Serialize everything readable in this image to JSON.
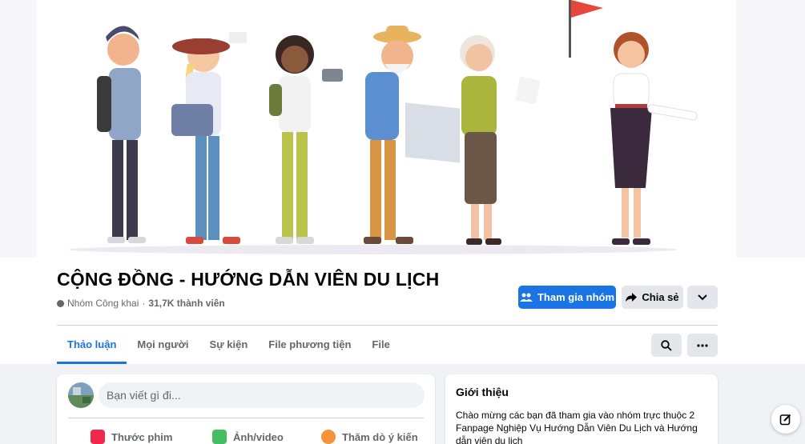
{
  "group": {
    "title": "CỘNG ĐỒNG - HƯỚNG DẪN VIÊN DU LỊCH",
    "privacy": "Nhóm Công khai",
    "separator": " · ",
    "members": "31,7K thành viên"
  },
  "actions": {
    "join_label": "Tham gia nhóm",
    "share_label": "Chia sẻ"
  },
  "tabs": [
    {
      "label": "Thảo luận",
      "active": true
    },
    {
      "label": "Mọi người",
      "active": false
    },
    {
      "label": "Sự kiện",
      "active": false
    },
    {
      "label": "File phương tiện",
      "active": false
    },
    {
      "label": "File",
      "active": false
    }
  ],
  "composer": {
    "placeholder": "Bạn viết gì đi...",
    "live_video": "Thước phim",
    "photo_video": "Ảnh/video",
    "poll": "Thăm dò ý kiến"
  },
  "about": {
    "title": "Giới thiệu",
    "text": "Chào mừng các bạn đã tham gia vào nhóm trực thuộc 2 Fanpage Nghiệp Vụ Hướng Dẫn Viên Du Lịch và Hướng dẫn viên du lịch"
  },
  "colors": {
    "primary": "#1b74e4",
    "secondary_button": "#e4e6eb",
    "background": "#f0f2f5"
  }
}
